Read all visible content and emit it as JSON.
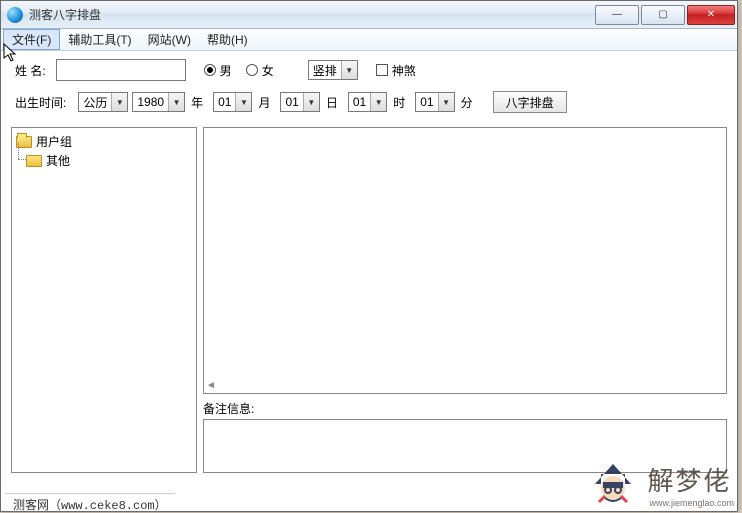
{
  "titlebar": {
    "title": "测客八字排盘"
  },
  "menu": {
    "file": "文件(F)",
    "tools": "辅助工具(T)",
    "site": "网站(W)",
    "help": "帮助(H)"
  },
  "form": {
    "name_label": "姓    名:",
    "name_value": "",
    "gender_male": "男",
    "gender_female": "女",
    "gender_selected": "male",
    "layout_select": "竖排",
    "shensha_label": "神煞",
    "birth_label": "出生时间:",
    "calendar_select": "公历",
    "year": "1980",
    "year_unit": "年",
    "month": "01",
    "month_unit": "月",
    "day": "01",
    "day_unit": "日",
    "hour": "01",
    "hour_unit": "时",
    "minute": "01",
    "minute_unit": "分",
    "calc_button": "八字排盘"
  },
  "tree": {
    "root": "用户组",
    "child1": "其他"
  },
  "remark": {
    "label": "备注信息:"
  },
  "status": {
    "text": "测客网（www.ceke8.com）"
  },
  "watermark": {
    "brand": "解梦佬",
    "url": "www.jiemenglao.com"
  }
}
